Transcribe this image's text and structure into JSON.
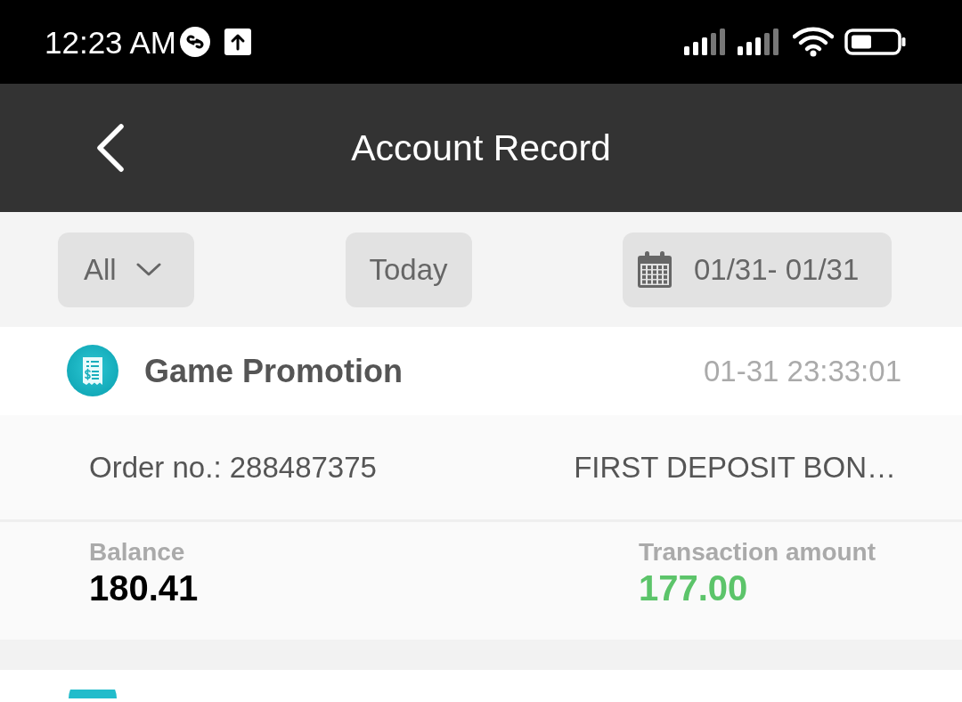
{
  "status_bar": {
    "time": "12:23 AM"
  },
  "header": {
    "title": "Account Record"
  },
  "filters": [
    {
      "kind": "dropdown",
      "label": "All"
    },
    {
      "kind": "preset",
      "label": "Today"
    },
    {
      "kind": "date_range",
      "label": "01/31- 01/31"
    }
  ],
  "records": [
    {
      "type": "Game Promotion",
      "time": "01-31 23:33:01",
      "order": "Order no.: 288487375",
      "description": "FIRST DEPOSIT BON…",
      "balance_label": "Balance",
      "balance": "180.41",
      "amount_label": "Transaction amount",
      "amount": "177.00"
    }
  ]
}
